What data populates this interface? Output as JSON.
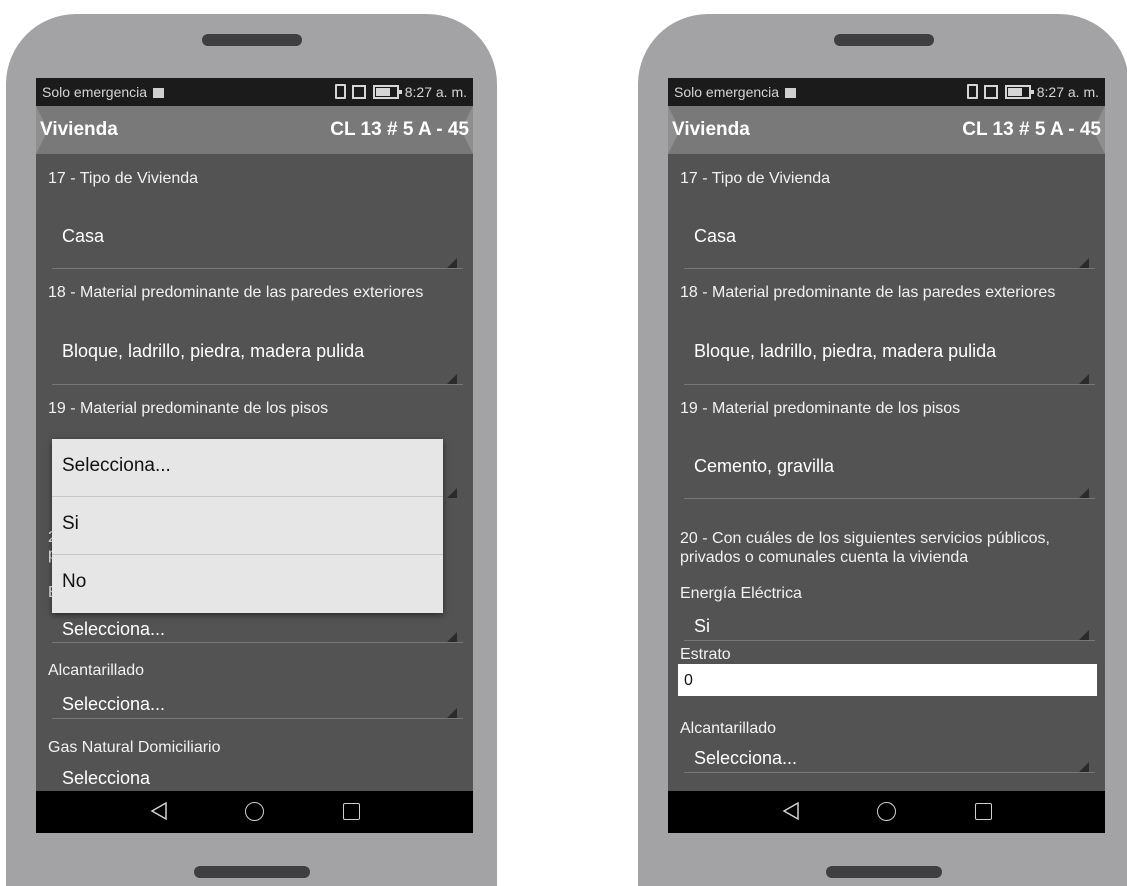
{
  "status_bar": {
    "carrier": "Solo emergencia",
    "time": "8:27 a. m."
  },
  "app_bar": {
    "title": "Vivienda",
    "address": "CL 13 # 5 A - 45"
  },
  "left": {
    "q17_label": "17 - Tipo de Vivienda",
    "q17_value": "Casa",
    "q18_label": "18 - Material predominante de las paredes exteriores",
    "q18_value": "Bloque, ladrillo, piedra, madera pulida",
    "q19_label": "19 - Material predominante de los pisos",
    "partial_q20_a": "2",
    "partial_q20_b": "p",
    "partial_energia": "E",
    "energia_value": "Selecciona...",
    "alcantarillado_label": "Alcantarillado",
    "alcantarillado_value": "Selecciona...",
    "gas_label": "Gas Natural Domiciliario",
    "gas_value": "Selecciona",
    "dropdown_options": [
      "Selecciona...",
      "Si",
      "No"
    ]
  },
  "right": {
    "q17_label": "17 - Tipo de Vivienda",
    "q17_value": "Casa",
    "q18_label": "18 - Material predominante de las paredes exteriores",
    "q18_value": "Bloque, ladrillo, piedra, madera pulida",
    "q19_label": "19 - Material predominante de los pisos",
    "q19_value": "Cemento, gravilla",
    "q20_label_line1": "20 - Con cuáles de los siguientes servicios públicos,",
    "q20_label_line2": "privados o comunales cuenta la vivienda",
    "energia_label": "Energía Eléctrica",
    "energia_value": "Si",
    "estrato_label": "Estrato",
    "estrato_value": "0",
    "alcantarillado_label": "Alcantarillado",
    "alcantarillado_value": "Selecciona..."
  },
  "nav": {
    "back_glyph": "◁"
  }
}
